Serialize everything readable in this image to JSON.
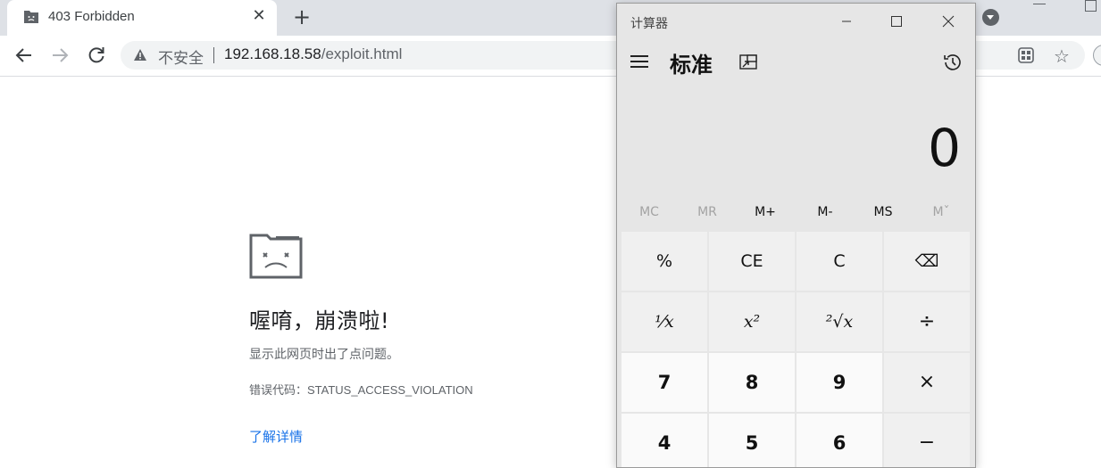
{
  "browser": {
    "tab_title": "403 Forbidden",
    "tab_close": "✕",
    "new_tab": "+",
    "security_label": "不安全",
    "url_host": "192.168.18.58",
    "url_path": "/exploit.html",
    "star": "☆"
  },
  "crash_page": {
    "title": "喔唷，崩溃啦!",
    "description": "显示此网页时出了点问题。",
    "error_code": "错误代码：STATUS_ACCESS_VIOLATION",
    "learn_more": "了解详情"
  },
  "calculator": {
    "app_title": "计算器",
    "mode": "标准",
    "display": "0",
    "memory": {
      "mc": "MC",
      "mr": "MR",
      "mplus": "M+",
      "mminus": "M-",
      "ms": "MS",
      "mlist": "Mˇ"
    },
    "keys": {
      "percent": "%",
      "ce": "CE",
      "c": "C",
      "backspace": "⌫",
      "reciprocal": "⅟x",
      "square": "x²",
      "sqrt": "²√x",
      "divide": "÷",
      "seven": "7",
      "eight": "8",
      "nine": "9",
      "multiply": "×",
      "four": "4",
      "five": "5",
      "six": "6",
      "minus": "−"
    }
  }
}
